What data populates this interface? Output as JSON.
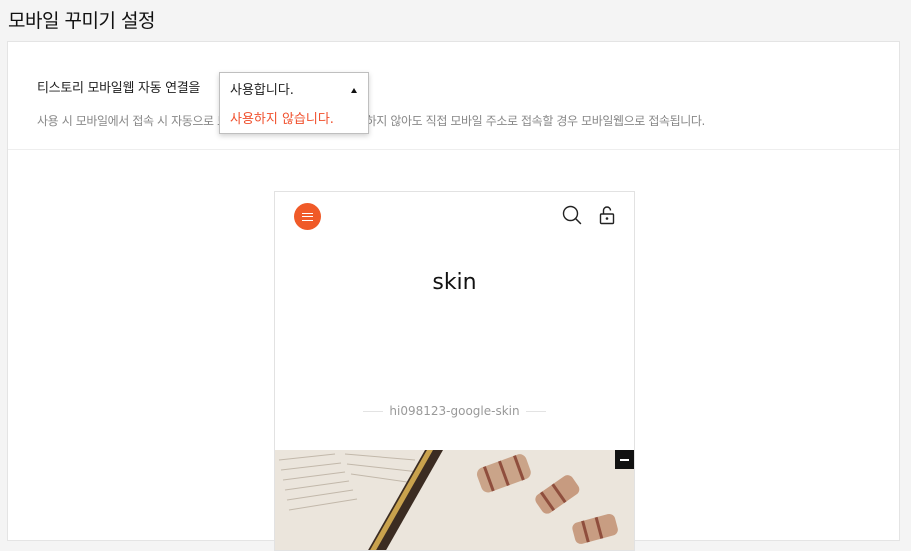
{
  "page": {
    "title": "모바일 꾸미기 설정"
  },
  "setting": {
    "label": "티스토리 모바일웹 자동 연결을",
    "description": "사용 시 모바일에서 접속 시 자동으로 모바일웹으로 연결됩니다. 사용하지 않아도 직접 모바일 주소로 접속할 경우 모바일웹으로 접속됩니다.",
    "dropdown": {
      "selected": "사용합니다.",
      "options": [
        "사용하지 않습니다."
      ],
      "option_color": "#f0502d"
    }
  },
  "preview": {
    "blog_title": "skin",
    "blog_subtitle": "hi098123-google-skin",
    "accent_color": "#f05a28",
    "icons": {
      "menu": "hamburger-menu-icon",
      "search": "search-icon",
      "lock": "lock-icon",
      "collapse": "minus-icon"
    }
  }
}
